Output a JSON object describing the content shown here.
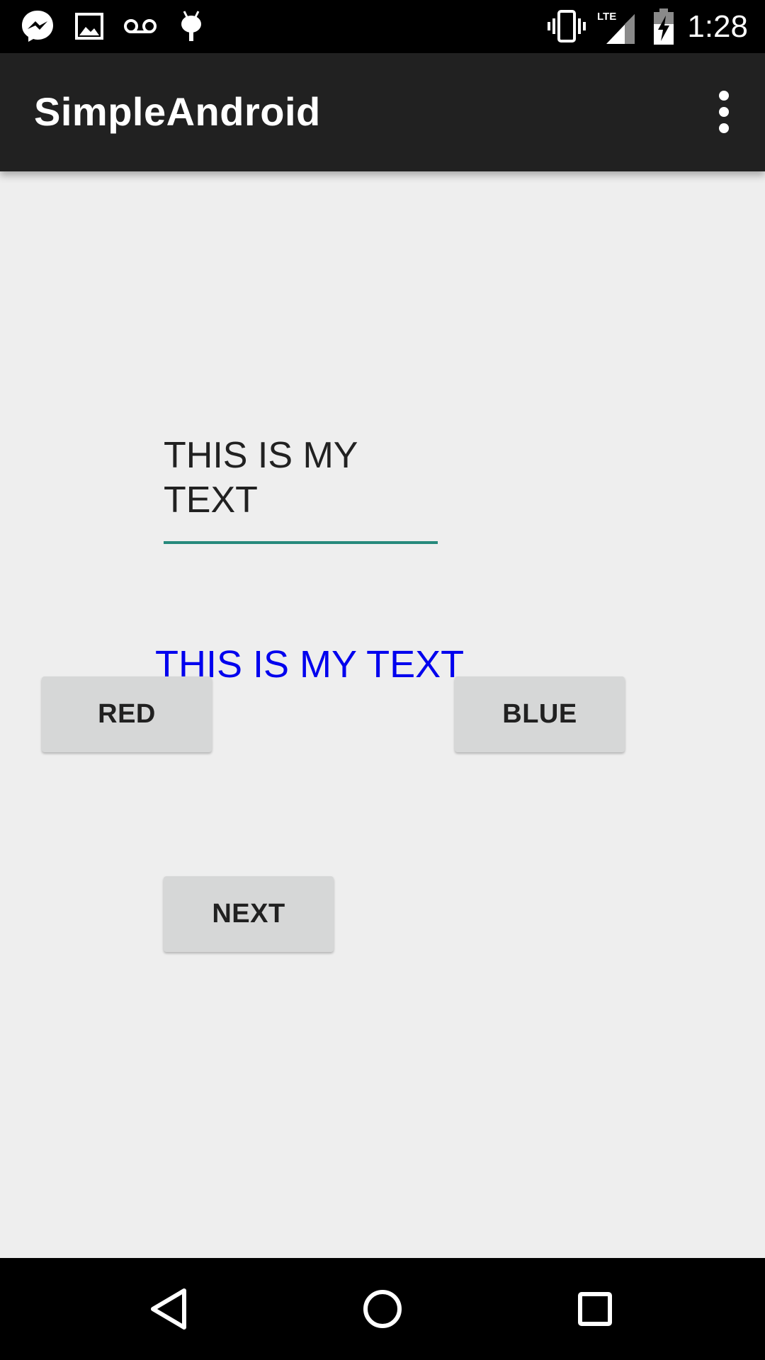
{
  "status_bar": {
    "time": "1:28",
    "notification_icons": [
      "messenger-icon",
      "image-icon",
      "voicemail-icon",
      "android-debug-icon"
    ],
    "system_icons": [
      "vibrate-icon",
      "lte-signal-icon",
      "battery-charging-icon"
    ],
    "network_label": "LTE"
  },
  "app_bar": {
    "title": "SimpleAndroid",
    "overflow_icon": "more-vert-icon"
  },
  "main": {
    "edit_text": {
      "line1": "THIS IS MY",
      "line2": "TEXT",
      "underline_color": "#26897b"
    },
    "colored_text": {
      "text": "THIS IS MY TEXT",
      "color": "#0000ee"
    },
    "buttons": {
      "red_label": "RED",
      "blue_label": "BLUE",
      "next_label": "NEXT"
    }
  },
  "nav_bar": {
    "back_icon": "back-triangle-icon",
    "home_icon": "home-circle-icon",
    "recent_icon": "recent-square-icon"
  }
}
